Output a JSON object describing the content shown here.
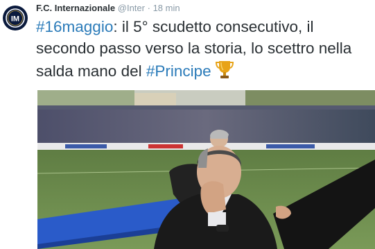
{
  "tweet": {
    "author_name": "F.C. Internazionale",
    "handle": "@Inter",
    "separator": "·",
    "time": "18 min",
    "text_parts": {
      "hashtag1": "#16maggio",
      "body": ": il 5° scudetto consecutivo, il secondo passo verso la storia, lo scettro nella salda mano del ",
      "hashtag2": "#Principe"
    }
  },
  "icons": {
    "avatar": "inter-logo-icon",
    "emoji": "trophy-icon"
  },
  "colors": {
    "hashtag": "#2b7bb9",
    "text": "#292f33",
    "meta": "#8899a6",
    "inter_navy": "#0a1a3d",
    "trophy_gold": "#e8a317"
  }
}
